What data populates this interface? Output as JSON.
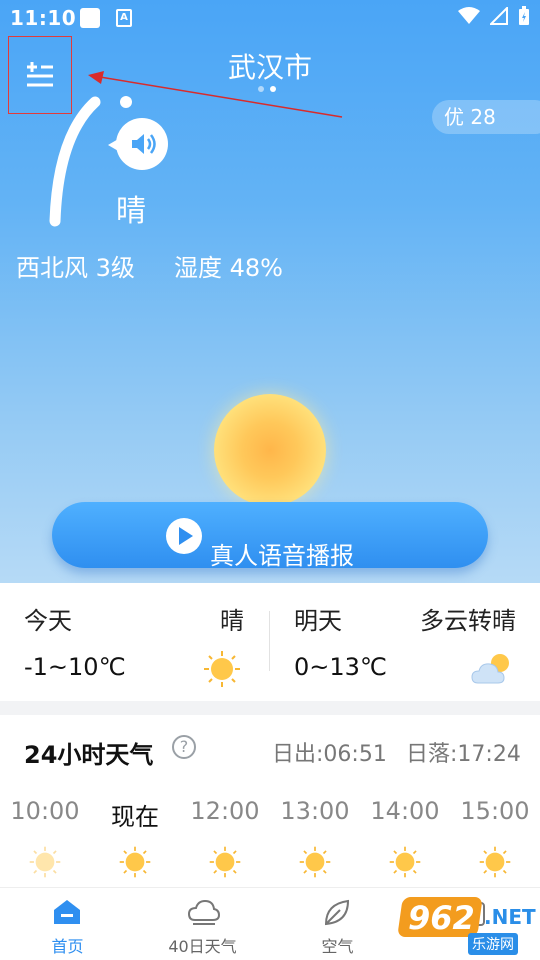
{
  "status_bar": {
    "time": "11:10"
  },
  "header": {
    "city": "武汉市",
    "aqi": "优 28"
  },
  "current": {
    "condition": "晴",
    "wind": "西北风 3级",
    "humidity": "湿度 48%"
  },
  "voice_button": {
    "label": "真人语音播报"
  },
  "days": {
    "today": {
      "title": "今天",
      "condition": "晴",
      "temp": "-1~10℃"
    },
    "tomorrow": {
      "title": "明天",
      "condition": "多云转晴",
      "temp": "0~13℃"
    }
  },
  "hours": {
    "title": "24小时天气",
    "help": "?",
    "sunrise": "日出:06:51",
    "sunset": "日落:17:24",
    "items": [
      {
        "label": "10:00",
        "icon": "sun-icon-faded"
      },
      {
        "label": "现在",
        "icon": "sun-icon"
      },
      {
        "label": "12:00",
        "icon": "sun-icon"
      },
      {
        "label": "13:00",
        "icon": "sun-icon"
      },
      {
        "label": "14:00",
        "icon": "sun-icon"
      },
      {
        "label": "15:00",
        "icon": "sun-icon"
      }
    ]
  },
  "nav": {
    "items": [
      {
        "label": "首页",
        "icon": "home-icon"
      },
      {
        "label": "40日天气",
        "icon": "cloud-icon"
      },
      {
        "label": "空气",
        "icon": "leaf-icon"
      },
      {
        "label": "",
        "icon": "calendar-icon"
      }
    ]
  },
  "watermark": {
    "number": "962",
    "net": ".NET",
    "sub": "乐游网"
  },
  "colors": {
    "accent": "#2f8ff0",
    "sky_top": "#4aa5f6",
    "sun": "#ffc85a"
  }
}
